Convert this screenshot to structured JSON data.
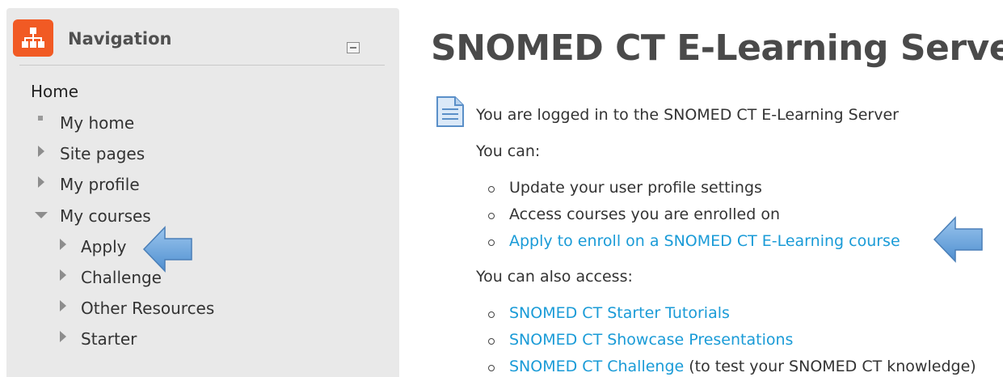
{
  "navigation": {
    "title": "Navigation",
    "home": "Home",
    "items": [
      {
        "label": "My home"
      },
      {
        "label": "Site pages"
      },
      {
        "label": "My profile"
      },
      {
        "label": "My courses"
      }
    ],
    "courses": [
      {
        "label": "Apply"
      },
      {
        "label": "Challenge"
      },
      {
        "label": "Other Resources"
      },
      {
        "label": "Starter"
      }
    ]
  },
  "main": {
    "title": "SNOMED CT E-Learning Server",
    "logged_in": "You are logged in to the SNOMED CT E-Learning Server",
    "you_can": "You can:",
    "can_items": [
      {
        "text": "Update your user profile settings"
      },
      {
        "text": "Access courses you are enrolled on"
      },
      {
        "text": "Apply to enroll on a SNOMED CT E-Learning course"
      }
    ],
    "also_access": "You can also access:",
    "access_items": [
      {
        "text": "SNOMED CT Starter Tutorials"
      },
      {
        "text": "SNOMED CT Showcase Presentations"
      },
      {
        "text": "SNOMED CT Challenge",
        "suffix": " (to test your SNOMED CT knowledge)"
      }
    ]
  },
  "colors": {
    "link": "#1a9bd7",
    "logo": "#f15a24",
    "panel": "#e9e9e9",
    "arrow": "#6aa7e0"
  }
}
